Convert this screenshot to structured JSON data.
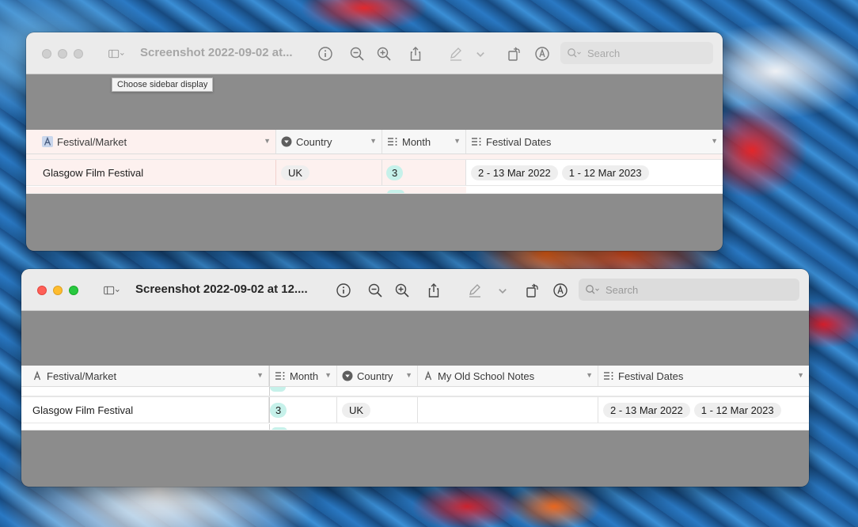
{
  "tooltip": "Choose sidebar display",
  "windows": [
    {
      "title": "Screenshot 2022-09-02 at...",
      "search_placeholder": "Search",
      "columns": [
        {
          "label": "Festival/Market",
          "icon": "text-field-icon"
        },
        {
          "label": "Country",
          "icon": "single-select-icon"
        },
        {
          "label": "Month",
          "icon": "multi-select-icon"
        },
        {
          "label": "Festival Dates",
          "icon": "multi-select-icon"
        }
      ],
      "row": {
        "festival": "Glasgow Film Festival",
        "country": "UK",
        "month": "3",
        "dates": [
          "2 - 13 Mar 2022",
          "1 - 12 Mar 2023"
        ]
      }
    },
    {
      "title": "Screenshot 2022-09-02 at 12....",
      "search_placeholder": "Search",
      "columns": [
        {
          "label": "Festival/Market",
          "icon": "text-field-icon"
        },
        {
          "label": "Month",
          "icon": "multi-select-icon"
        },
        {
          "label": "Country",
          "icon": "single-select-icon"
        },
        {
          "label": "My Old School Notes",
          "icon": "text-field-icon"
        },
        {
          "label": "Festival Dates",
          "icon": "multi-select-icon"
        }
      ],
      "row": {
        "festival": "Glasgow Film Festival",
        "month": "3",
        "country": "UK",
        "notes": "",
        "dates": [
          "2 - 13 Mar 2022",
          "1 - 12 Mar 2023"
        ]
      }
    }
  ],
  "colors": {
    "teal_pill": "#c6f1ea",
    "gray_pill": "#eeeeee",
    "primary_field_tint": "#fdf1ef",
    "traffic_red": "#fe5f57",
    "traffic_yellow": "#febc2e",
    "traffic_green": "#28c840"
  }
}
